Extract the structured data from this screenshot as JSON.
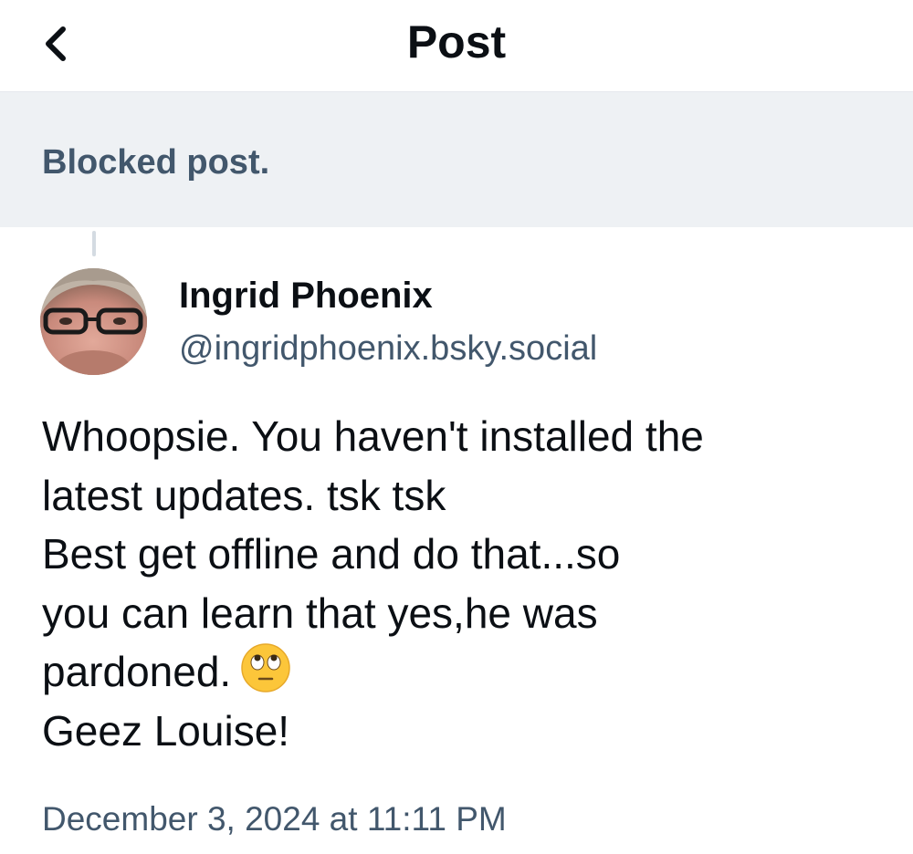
{
  "header": {
    "title": "Post",
    "back_icon": "chevron-left-icon"
  },
  "blocked": {
    "text": "Blocked post."
  },
  "author": {
    "name": "Ingrid Phoenix",
    "handle": "@ingridphoenix.bsky.social",
    "avatar_icon": "user-avatar-photo"
  },
  "post": {
    "lines": [
      "Whoopsie. You haven't installed the",
      "latest updates. tsk tsk",
      "Best get offline and do that...so",
      "you can learn that yes,he was",
      "pardoned.",
      "Geez Louise!"
    ],
    "emoji": "face-with-rolling-eyes"
  },
  "timestamp": "December 3, 2024 at 11:11 PM",
  "colors": {
    "text_primary": "#0b0f14",
    "text_secondary": "#42576c",
    "banner_bg": "#eef1f4",
    "thread_line": "#d4dbe2"
  }
}
